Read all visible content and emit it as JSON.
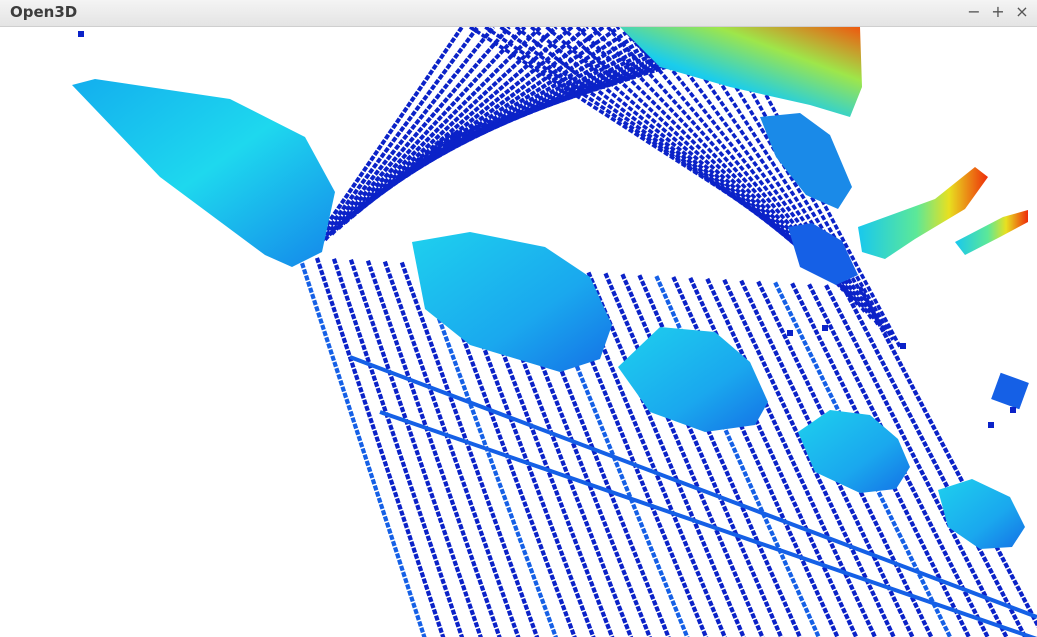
{
  "window": {
    "title": "Open3D",
    "controls": {
      "minimize": "−",
      "maximize": "+",
      "close": "×"
    }
  },
  "viewer": {
    "background_color": "#ffffff",
    "colormap": [
      "#0b22c8",
      "#1560e6",
      "#12a6ee",
      "#18d0ea",
      "#3ee6b6",
      "#c8ec28",
      "#f6a40c",
      "#ee2c0a"
    ]
  }
}
